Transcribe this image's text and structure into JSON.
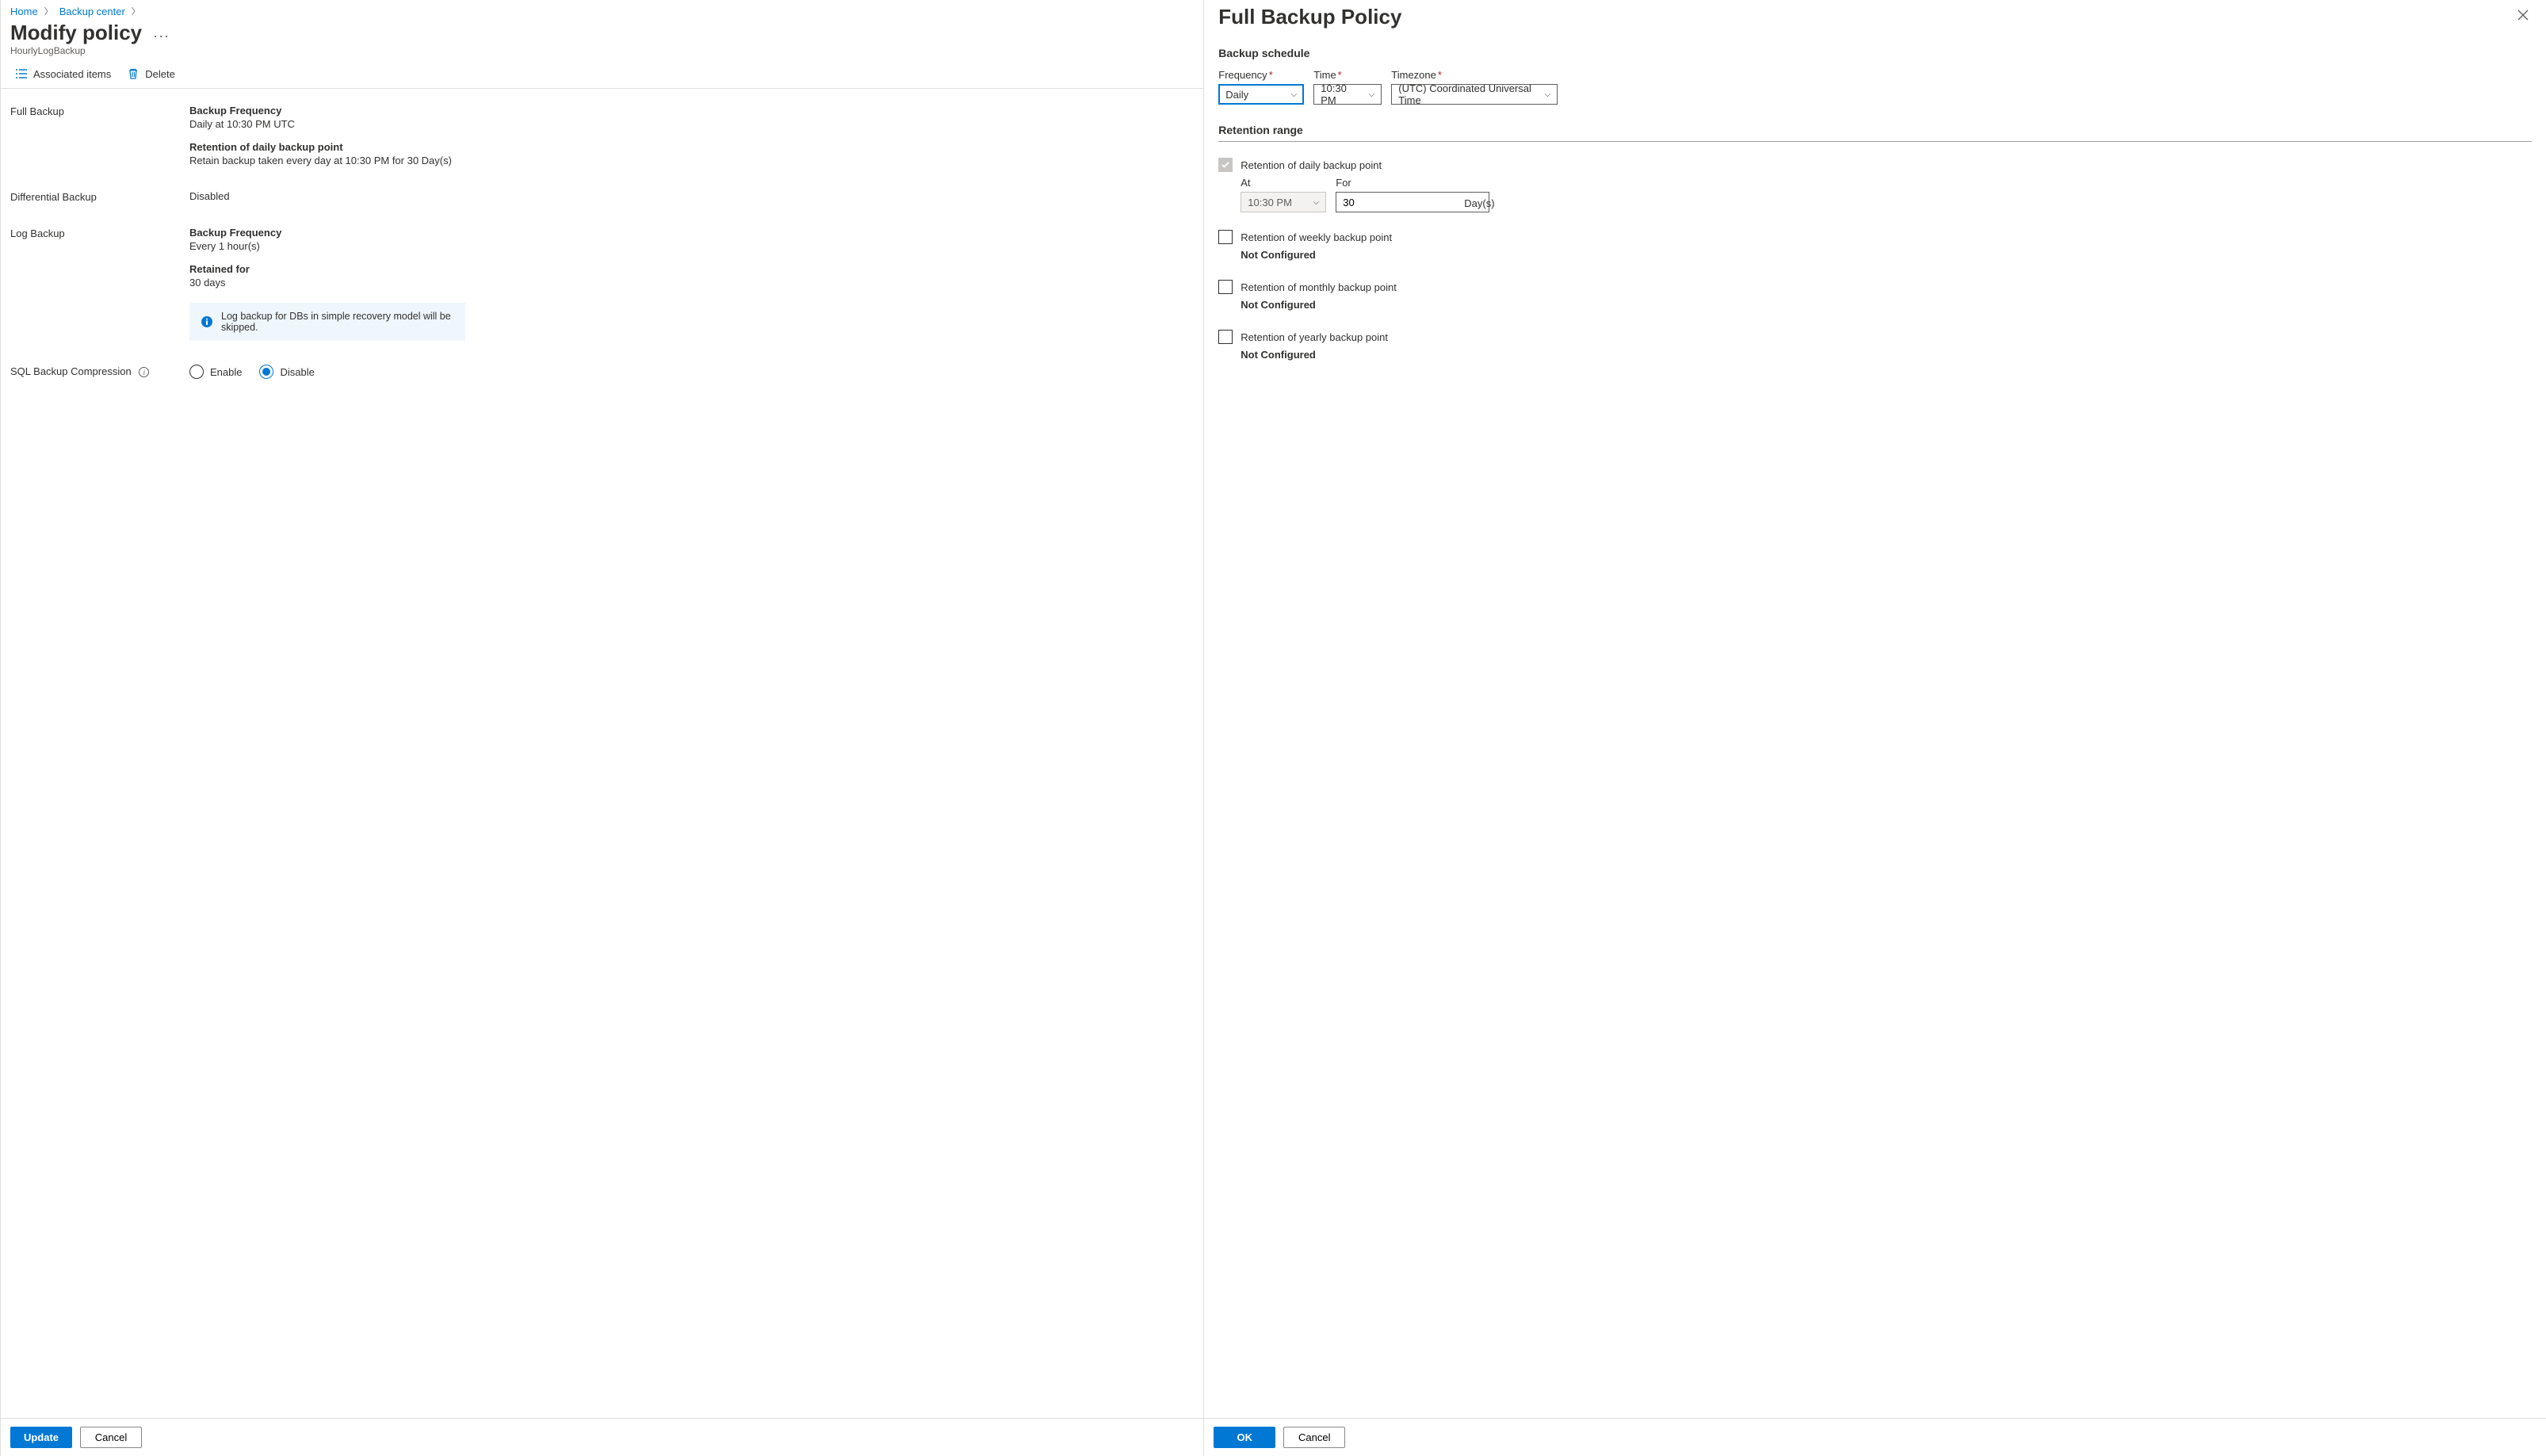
{
  "breadcrumb": {
    "home": "Home",
    "backup_center": "Backup center"
  },
  "page_title": "Modify policy",
  "page_subtitle": "HourlyLogBackup",
  "commands": {
    "associated_items": "Associated items",
    "delete": "Delete"
  },
  "sections": {
    "full_backup": {
      "label": "Full Backup",
      "freq_heading": "Backup Frequency",
      "freq_text": "Daily at 10:30 PM UTC",
      "retention_heading": "Retention of daily backup point",
      "retention_text": "Retain backup taken every day at 10:30 PM for 30 Day(s)"
    },
    "differential": {
      "label": "Differential Backup",
      "text": "Disabled"
    },
    "log_backup": {
      "label": "Log Backup",
      "freq_heading": "Backup Frequency",
      "freq_text": "Every 1 hour(s)",
      "retained_heading": "Retained for",
      "retained_text": "30 days",
      "info_text": "Log backup for DBs in simple recovery model will be skipped."
    },
    "compression": {
      "label": "SQL Backup Compression",
      "enable": "Enable",
      "disable": "Disable"
    }
  },
  "footer": {
    "update": "Update",
    "cancel": "Cancel"
  },
  "blade": {
    "title": "Full Backup Policy",
    "schedule_header": "Backup schedule",
    "frequency_label": "Frequency",
    "frequency_value": "Daily",
    "time_label": "Time",
    "time_value": "10:30 PM",
    "timezone_label": "Timezone",
    "timezone_value": "(UTC) Coordinated Universal Time",
    "retention_header": "Retention range",
    "daily": {
      "label": "Retention of daily backup point",
      "at_label": "At",
      "at_value": "10:30 PM",
      "for_label": "For",
      "for_value": "30",
      "days_suffix": "Day(s)"
    },
    "weekly": {
      "label": "Retention of weekly backup point",
      "status": "Not Configured"
    },
    "monthly": {
      "label": "Retention of monthly backup point",
      "status": "Not Configured"
    },
    "yearly": {
      "label": "Retention of yearly backup point",
      "status": "Not Configured"
    },
    "ok": "OK",
    "cancel": "Cancel"
  }
}
